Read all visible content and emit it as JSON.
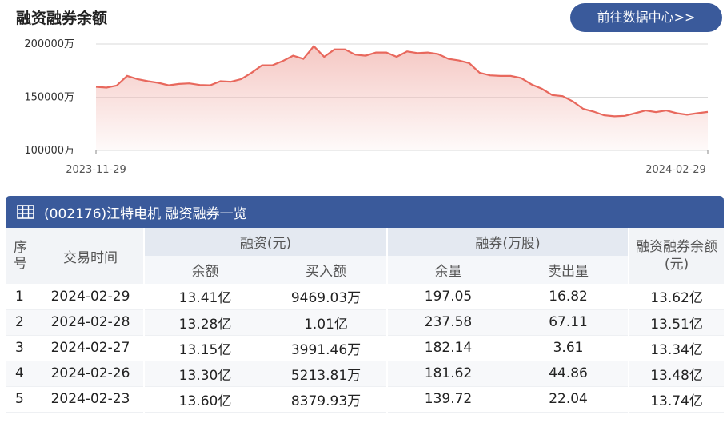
{
  "header": {
    "title": "融资融券余额",
    "goto_button": "前往数据中心>>"
  },
  "chart_data": {
    "type": "area",
    "unit": "万",
    "ylim": [
      100000,
      200000
    ],
    "yticks": [
      "200000万",
      "150000万",
      "100000万"
    ],
    "ytick_values": [
      200000,
      150000,
      100000
    ],
    "x_start_label": "2023-11-29",
    "x_end_label": "2024-02-29",
    "grid": true,
    "line_color": "#e8685d",
    "fill_color": "#f4c2bd",
    "values": [
      159800,
      159000,
      161000,
      170000,
      167000,
      165000,
      163500,
      161200,
      162500,
      163000,
      161500,
      161200,
      165000,
      164500,
      167000,
      173000,
      180000,
      180000,
      184000,
      189000,
      186000,
      198000,
      188000,
      195000,
      195000,
      190000,
      189000,
      192000,
      192000,
      188000,
      193000,
      191500,
      192000,
      190500,
      186000,
      184500,
      182000,
      173000,
      170500,
      170000,
      170000,
      168000,
      162000,
      158000,
      152000,
      151000,
      146000,
      139000,
      136500,
      133000,
      132000,
      132500,
      135000,
      137500,
      136000,
      137500,
      135000,
      133500,
      135000,
      136200
    ]
  },
  "table": {
    "title": "(002176)江特电机 融资融券一览",
    "headers": {
      "index": "序号",
      "date": "交易时间",
      "margin_group": "融资(元)",
      "margin_balance": "余额",
      "margin_buy": "买入额",
      "short_group": "融券(万股)",
      "short_balance": "余量",
      "short_sell": "卖出量",
      "total": "融资融券余额(元)"
    },
    "rows": [
      {
        "idx": "1",
        "date": "2024-02-29",
        "mbal": "13.41亿",
        "mbuy": "9469.03万",
        "sbal": "197.05",
        "ssell": "16.82",
        "total": "13.62亿"
      },
      {
        "idx": "2",
        "date": "2024-02-28",
        "mbal": "13.28亿",
        "mbuy": "1.01亿",
        "sbal": "237.58",
        "ssell": "67.11",
        "total": "13.51亿"
      },
      {
        "idx": "3",
        "date": "2024-02-27",
        "mbal": "13.15亿",
        "mbuy": "3991.46万",
        "sbal": "182.14",
        "ssell": "3.61",
        "total": "13.34亿"
      },
      {
        "idx": "4",
        "date": "2024-02-26",
        "mbal": "13.30亿",
        "mbuy": "5213.81万",
        "sbal": "181.62",
        "ssell": "44.86",
        "total": "13.48亿"
      },
      {
        "idx": "5",
        "date": "2024-02-23",
        "mbal": "13.60亿",
        "mbuy": "8379.93万",
        "sbal": "139.72",
        "ssell": "22.04",
        "total": "13.74亿"
      }
    ]
  }
}
